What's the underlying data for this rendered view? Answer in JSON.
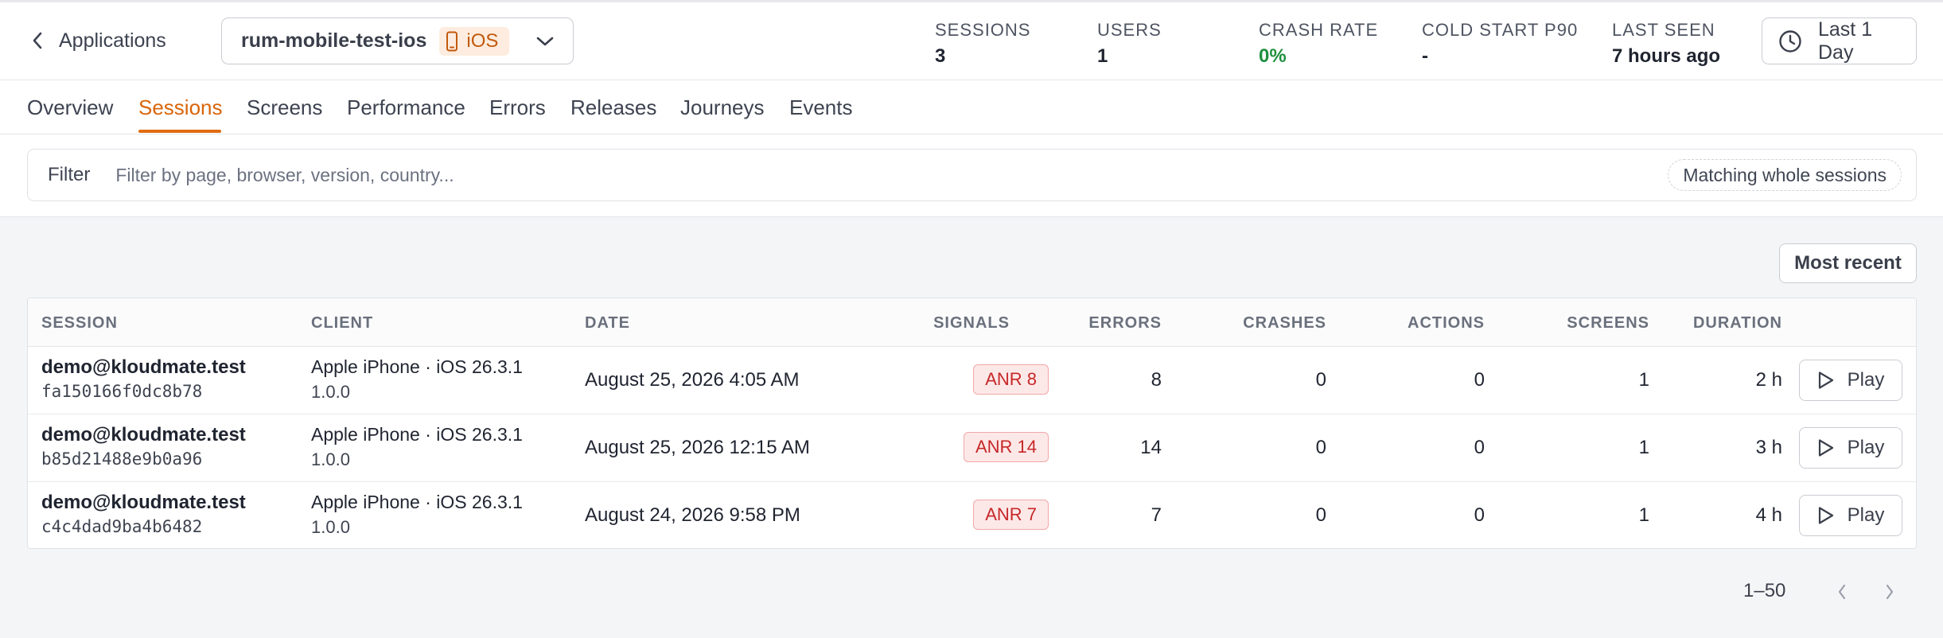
{
  "header": {
    "back_label": "Applications",
    "app_name": "rum-mobile-test-ios",
    "platform": "iOS",
    "stats": [
      {
        "label": "SESSIONS",
        "value": "3"
      },
      {
        "label": "USERS",
        "value": "1"
      },
      {
        "label": "CRASH RATE",
        "value": "0%"
      },
      {
        "label": "COLD START P90",
        "value": "-"
      },
      {
        "label": "LAST SEEN",
        "value": "7 hours ago"
      }
    ],
    "time_range": "Last 1 Day"
  },
  "tabs": [
    "Overview",
    "Sessions",
    "Screens",
    "Performance",
    "Errors",
    "Releases",
    "Journeys",
    "Events"
  ],
  "active_tab": "Sessions",
  "filter": {
    "label": "Filter",
    "placeholder": "Filter by page, browser, version, country...",
    "value": "",
    "match_mode": "Matching whole sessions"
  },
  "sort_label": "Most recent",
  "table": {
    "columns": [
      "SESSION",
      "CLIENT",
      "DATE",
      "SIGNALS",
      "ERRORS",
      "CRASHES",
      "ACTIONS",
      "SCREENS",
      "DURATION"
    ],
    "rows": [
      {
        "user": "demo@kloudmate.test",
        "session_id": "fa150166f0dc8b78",
        "client": "Apple iPhone · iOS 26.3.1",
        "version": "1.0.0",
        "date": "August 25, 2026 4:05 AM",
        "signal": "ANR 8",
        "errors": "8",
        "crashes": "0",
        "actions": "0",
        "screens": "1",
        "duration": "2 h",
        "action_label": "Play"
      },
      {
        "user": "demo@kloudmate.test",
        "session_id": "b85d21488e9b0a96",
        "client": "Apple iPhone · iOS 26.3.1",
        "version": "1.0.0",
        "date": "August 25, 2026 12:15 AM",
        "signal": "ANR 14",
        "errors": "14",
        "crashes": "0",
        "actions": "0",
        "screens": "1",
        "duration": "3 h",
        "action_label": "Play"
      },
      {
        "user": "demo@kloudmate.test",
        "session_id": "c4c4dad9ba4b6482",
        "client": "Apple iPhone · iOS 26.3.1",
        "version": "1.0.0",
        "date": "August 24, 2026 9:58 PM",
        "signal": "ANR 7",
        "errors": "7",
        "crashes": "0",
        "actions": "0",
        "screens": "1",
        "duration": "4 h",
        "action_label": "Play"
      }
    ]
  },
  "pagination": {
    "range": "1–50"
  },
  "colors": {
    "accent": "#e06d12",
    "success": "#1f8f3e",
    "danger": "#c62828"
  },
  "icons": [
    "chevron-left-icon",
    "phone-icon",
    "chevron-down-icon",
    "clock-icon",
    "play-icon",
    "chevron-right-icon"
  ]
}
